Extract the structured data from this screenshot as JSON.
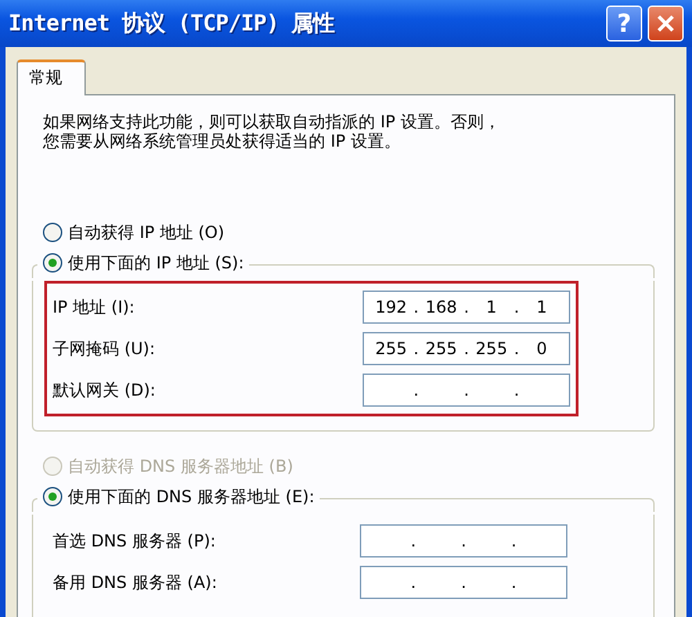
{
  "window": {
    "title": "Internet 协议 (TCP/IP) 属性",
    "buttons": [
      {
        "kind": "help",
        "label": "?"
      },
      {
        "kind": "close"
      }
    ]
  },
  "tabs": [
    {
      "label": "常规",
      "selected": true
    }
  ],
  "description": [
    "如果网络支持此功能，则可以获取自动指派的 IP 设置。否则，",
    "您需要从网络系统管理员处获得适当的 IP 设置。"
  ],
  "ip_section": {
    "options": [
      {
        "label": "自动获得 IP 地址 (O)",
        "selected": false,
        "disabled": false
      },
      {
        "label": "使用下面的 IP 地址 (S):",
        "selected": true,
        "disabled": false
      }
    ],
    "highlighted": true,
    "fields": [
      {
        "label": "IP 地址 (I):",
        "octets": [
          "192",
          "168",
          "1",
          "1"
        ],
        "separators": [
          ".",
          ".",
          "."
        ]
      },
      {
        "label": "子网掩码 (U):",
        "octets": [
          "255",
          "255",
          "255",
          "0"
        ],
        "separators": [
          ".",
          ".",
          "."
        ]
      },
      {
        "label": "默认网关 (D):",
        "separators": [
          ".",
          ".",
          "."
        ]
      }
    ]
  },
  "dns_section": {
    "options": [
      {
        "label": "自动获得 DNS 服务器地址 (B)",
        "selected": false,
        "disabled": true
      },
      {
        "label": "使用下面的 DNS 服务器地址 (E):",
        "selected": true,
        "disabled": false
      }
    ],
    "fields": [
      {
        "label": "首选 DNS 服务器 (P):",
        "separators": [
          ".",
          ".",
          "."
        ]
      },
      {
        "label": "备用 DNS 服务器 (A):",
        "separators": [
          ".",
          ".",
          "."
        ]
      }
    ]
  }
}
